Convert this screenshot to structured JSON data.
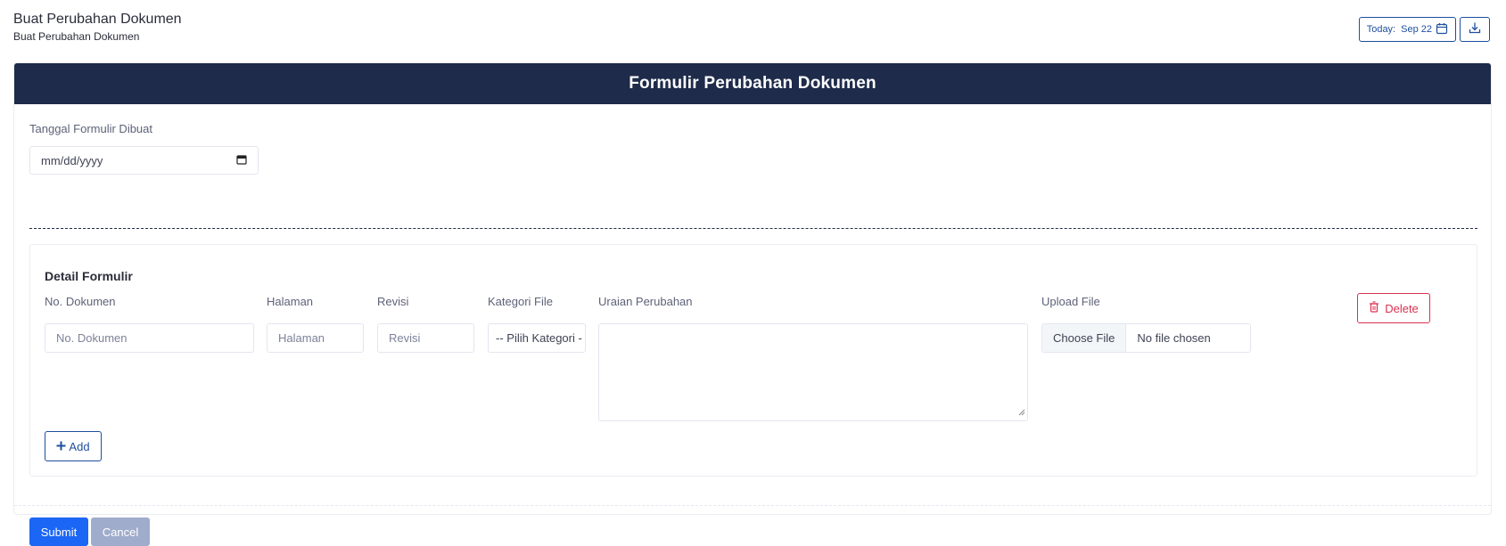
{
  "header": {
    "title": "Buat Perubahan Dokumen",
    "subtitle": "Buat Perubahan Dokumen",
    "today_label": "Today:",
    "today_date": "Sep 22"
  },
  "form": {
    "heading": "Formulir Perubahan Dokumen",
    "date_label": "Tanggal Formulir Dibuat",
    "date_placeholder": "mm/dd/yyyy",
    "detail_title": "Detail Formulir",
    "columns": {
      "no_dokumen": {
        "label": "No. Dokumen",
        "placeholder": "No. Dokumen"
      },
      "halaman": {
        "label": "Halaman",
        "placeholder": "Halaman"
      },
      "revisi": {
        "label": "Revisi",
        "placeholder": "Revisi"
      },
      "kategori": {
        "label": "Kategori File",
        "selected": "-- Pilih Kategori -"
      },
      "uraian": {
        "label": "Uraian Perubahan",
        "value": ""
      },
      "upload": {
        "label": "Upload File",
        "button": "Choose File",
        "status": "No file chosen"
      }
    },
    "delete_label": "Delete",
    "add_label": "Add",
    "submit_label": "Submit",
    "cancel_label": "Cancel"
  },
  "colors": {
    "header_bg": "#1e2b4a",
    "primary": "#1c66f5",
    "outline": "#1e4f9e",
    "danger": "#d9314f",
    "cancel": "#a0accc"
  },
  "icons": {
    "calendar": "calendar-icon",
    "download": "download-icon",
    "trash": "trash-icon",
    "plus": "plus-icon"
  }
}
